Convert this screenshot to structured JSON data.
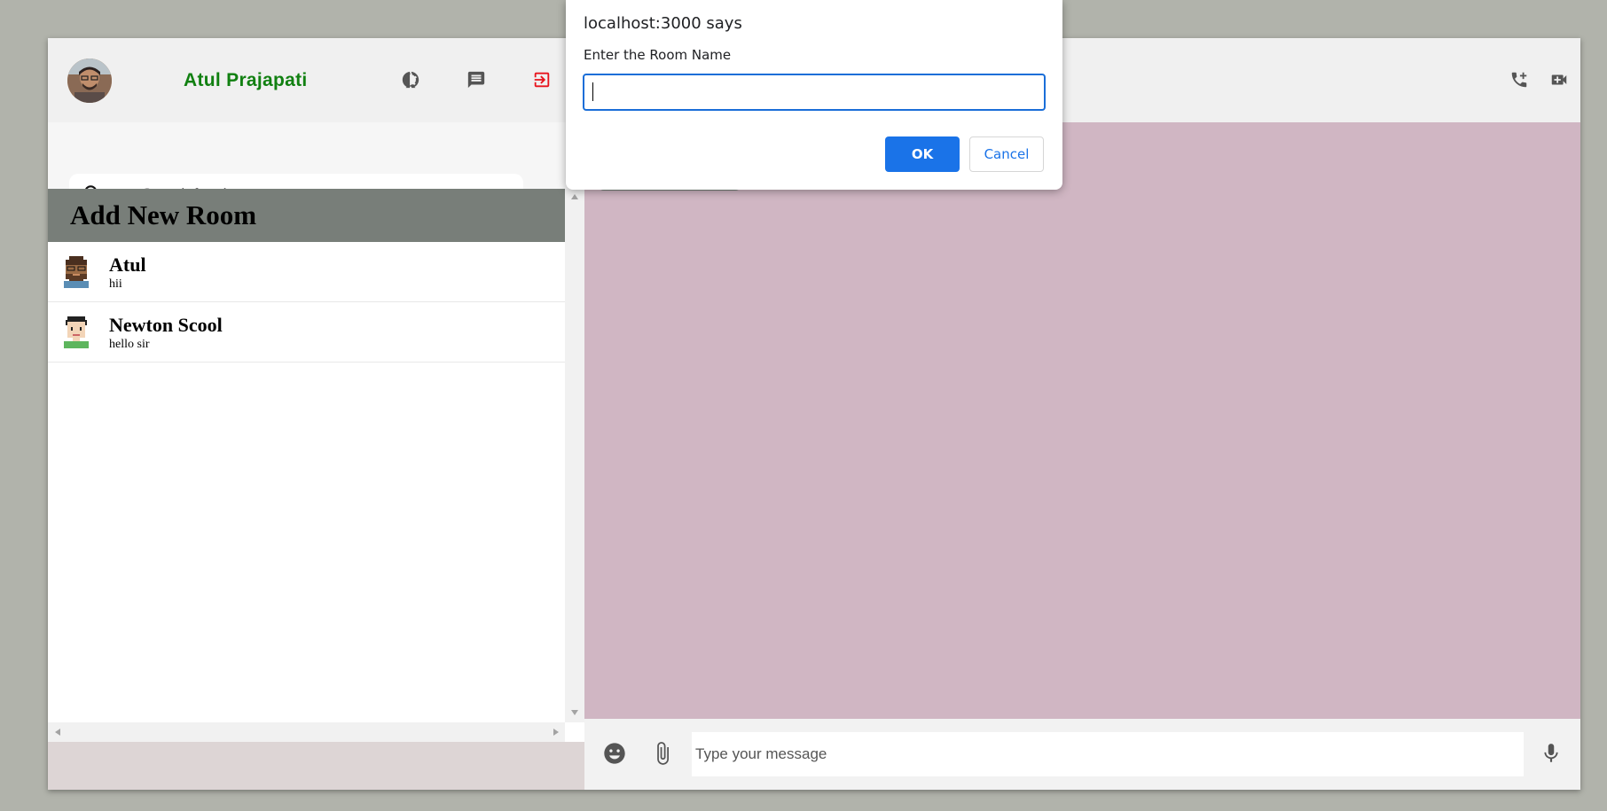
{
  "sidebar": {
    "username": "Atul Prajapati",
    "username_color": "#118011",
    "icons": [
      "status-icon",
      "new-chat-icon",
      "logout-icon"
    ],
    "search": {
      "placeholder": "Search for chat"
    },
    "add_room_label": "Add New Room",
    "chats": [
      {
        "name": "Atul",
        "last_message": "hii"
      },
      {
        "name": "Newton Scool",
        "last_message": "hello sir"
      }
    ]
  },
  "chat": {
    "header_icons": [
      "add-call-icon",
      "video-call-icon",
      "more-vert-icon"
    ],
    "background_color": "#d0b6c3",
    "input": {
      "placeholder": "Type your message"
    },
    "footer_icons": [
      "emoji-icon",
      "attach-icon",
      "mic-icon"
    ]
  },
  "dialog": {
    "title": "localhost:3000 says",
    "message": "Enter the Room Name",
    "input_value": "",
    "ok_label": "OK",
    "cancel_label": "Cancel"
  }
}
